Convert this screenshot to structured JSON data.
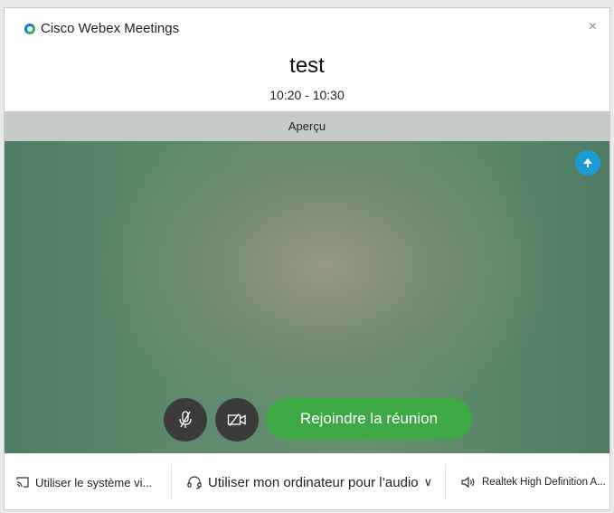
{
  "app": {
    "title": "Cisco Webex Meetings",
    "close_glyph": "×"
  },
  "meeting": {
    "title": "test",
    "time": "10:20 - 10:30"
  },
  "preview": {
    "header": "Aperçu"
  },
  "controls": {
    "mic_icon": "mic-off-icon",
    "camera_icon": "camera-off-icon",
    "join_label": "Rejoindre la réunion"
  },
  "bottom_bar": {
    "video_system_label": "Utiliser le système vi...",
    "audio_label": "Utiliser mon ordinateur pour l’audio",
    "audio_dropdown_glyph": "∨",
    "speaker_label": "Realtek High Definition A..."
  },
  "colors": {
    "accent_blue": "#1c9ad6",
    "join_green": "#3ea844",
    "control_dark": "#3b3b3b"
  }
}
